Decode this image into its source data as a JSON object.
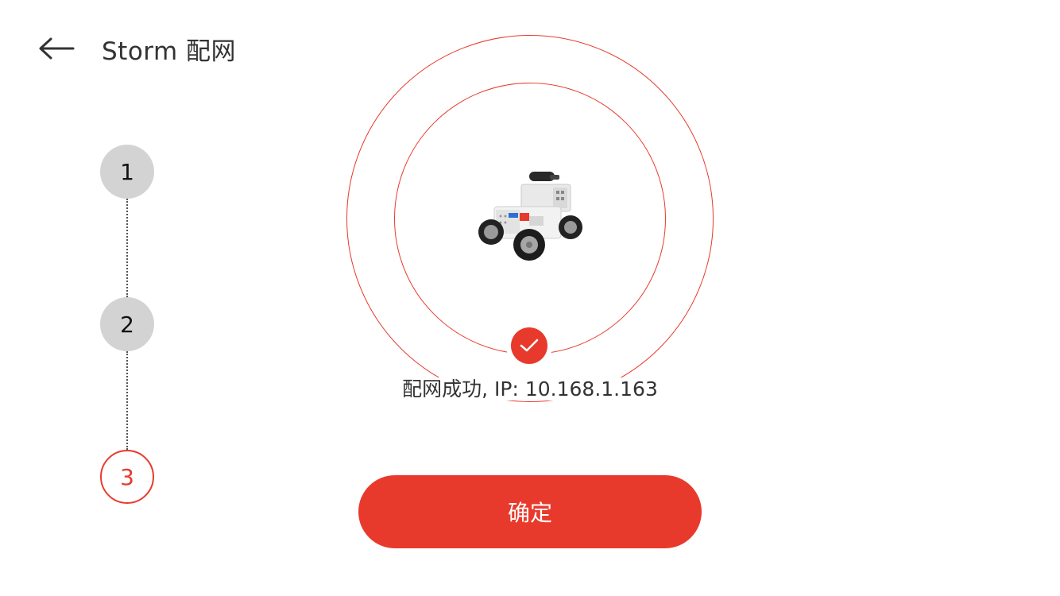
{
  "header": {
    "title": "Storm 配网",
    "back_icon": "arrow-left-icon"
  },
  "stepper": {
    "steps": [
      {
        "label": "1",
        "state": "done"
      },
      {
        "label": "2",
        "state": "done"
      },
      {
        "label": "3",
        "state": "active"
      }
    ]
  },
  "main": {
    "device_image": "robot-car-image",
    "success_icon": "check-icon",
    "status": "配网成功, IP: 10.168.1.163"
  },
  "actions": {
    "confirm_label": "确定"
  },
  "colors": {
    "accent": "#e83a2c",
    "step_done_bg": "#d3d3d3",
    "text": "#333333"
  }
}
